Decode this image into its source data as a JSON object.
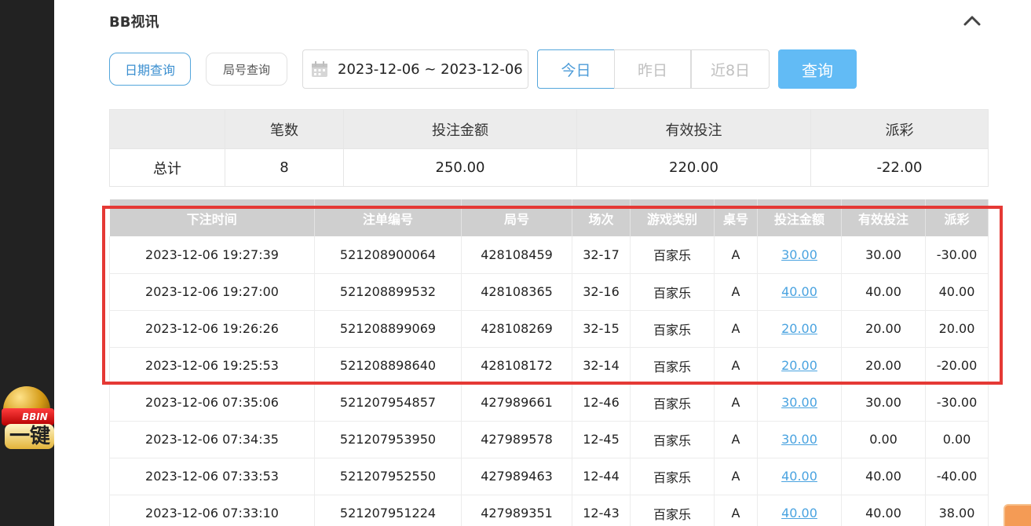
{
  "panel": {
    "title": "BB视讯"
  },
  "promo": {
    "banner": "BBIN",
    "big": "一键"
  },
  "filters": {
    "date_query": "日期查询",
    "round_query": "局号查询",
    "date_range": "2023-12-06 ~ 2023-12-06",
    "today": "今日",
    "yesterday": "昨日",
    "last8": "近8日",
    "query_btn": "查询"
  },
  "summary": {
    "headers": [
      "",
      "笔数",
      "投注金额",
      "有效投注",
      "派彩"
    ],
    "row": {
      "label": "总计",
      "count": "8",
      "bet": "250.00",
      "valid": "220.00",
      "payout": "-22.00"
    }
  },
  "detail": {
    "headers": [
      "下注时间",
      "注单编号",
      "局号",
      "场次",
      "游戏类别",
      "桌号",
      "投注金额",
      "有效投注",
      "派彩"
    ],
    "rows": [
      {
        "time": "2023-12-06 19:27:39",
        "order": "521208900064",
        "round": "428108459",
        "session": "32-17",
        "game": "百家乐",
        "table": "A",
        "bet": "30.00",
        "valid": "30.00",
        "payout": "-30.00"
      },
      {
        "time": "2023-12-06 19:27:00",
        "order": "521208899532",
        "round": "428108365",
        "session": "32-16",
        "game": "百家乐",
        "table": "A",
        "bet": "40.00",
        "valid": "40.00",
        "payout": "40.00"
      },
      {
        "time": "2023-12-06 19:26:26",
        "order": "521208899069",
        "round": "428108269",
        "session": "32-15",
        "game": "百家乐",
        "table": "A",
        "bet": "20.00",
        "valid": "20.00",
        "payout": "20.00"
      },
      {
        "time": "2023-12-06 19:25:53",
        "order": "521208898640",
        "round": "428108172",
        "session": "32-14",
        "game": "百家乐",
        "table": "A",
        "bet": "20.00",
        "valid": "20.00",
        "payout": "-20.00"
      },
      {
        "time": "2023-12-06 07:35:06",
        "order": "521207954857",
        "round": "427989661",
        "session": "12-46",
        "game": "百家乐",
        "table": "A",
        "bet": "30.00",
        "valid": "30.00",
        "payout": "-30.00"
      },
      {
        "time": "2023-12-06 07:34:35",
        "order": "521207953950",
        "round": "427989578",
        "session": "12-45",
        "game": "百家乐",
        "table": "A",
        "bet": "30.00",
        "valid": "0.00",
        "payout": "0.00"
      },
      {
        "time": "2023-12-06 07:33:53",
        "order": "521207952550",
        "round": "427989463",
        "session": "12-44",
        "game": "百家乐",
        "table": "A",
        "bet": "40.00",
        "valid": "40.00",
        "payout": "-40.00"
      },
      {
        "time": "2023-12-06 07:33:10",
        "order": "521207951224",
        "round": "427989351",
        "session": "12-43",
        "game": "百家乐",
        "table": "A",
        "bet": "40.00",
        "valid": "40.00",
        "payout": "38.00"
      }
    ]
  },
  "colors": {
    "accent": "#62bbf5",
    "negative": "#e8394b",
    "highlight": "#e53935"
  }
}
